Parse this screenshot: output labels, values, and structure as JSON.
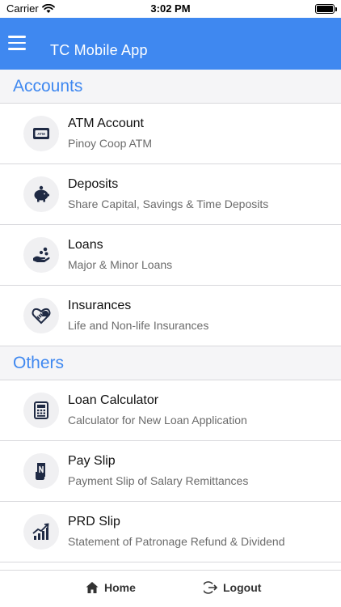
{
  "status_bar": {
    "carrier": "Carrier",
    "time": "3:02 PM"
  },
  "app_bar": {
    "title": "TC Mobile App"
  },
  "sections": [
    {
      "title": "Accounts",
      "items": [
        {
          "title": "ATM Account",
          "subtitle": "Pinoy Coop ATM",
          "icon": "atm-card-icon"
        },
        {
          "title": "Deposits",
          "subtitle": "Share Capital, Savings & Time Deposits",
          "icon": "piggy-bank-icon"
        },
        {
          "title": "Loans",
          "subtitle": "Major & Minor Loans",
          "icon": "hand-coins-icon"
        },
        {
          "title": "Insurances",
          "subtitle": "Life and Non-life Insurances",
          "icon": "heart-hand-icon"
        }
      ]
    },
    {
      "title": "Others",
      "items": [
        {
          "title": "Loan Calculator",
          "subtitle": "Calculator for New Loan Application",
          "icon": "calculator-icon"
        },
        {
          "title": "Pay Slip",
          "subtitle": "Payment Slip of Salary Remittances",
          "icon": "payslip-icon"
        },
        {
          "title": "PRD Slip",
          "subtitle": "Statement of Patronage Refund & Dividend",
          "icon": "growth-chart-icon"
        }
      ]
    }
  ],
  "tab_bar": {
    "home_label": "Home",
    "logout_label": "Logout"
  },
  "colors": {
    "accent": "#3f88f0",
    "section_bg": "#f5f5f7",
    "icon_dark": "#1f2a44"
  }
}
